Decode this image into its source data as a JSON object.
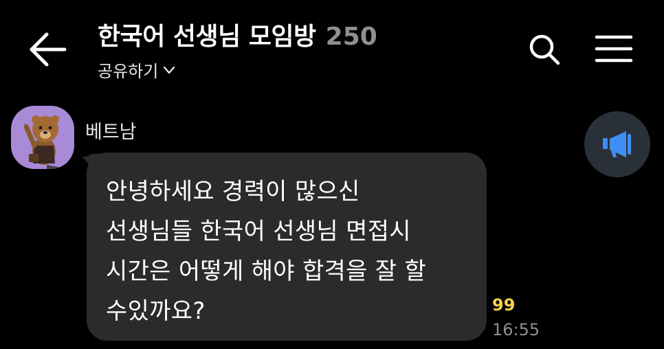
{
  "header": {
    "title": "한국어 선생님 모임방",
    "member_count": "250",
    "share_label": "공유하기"
  },
  "icons": {
    "back": "arrow-left-icon",
    "search": "search-icon",
    "menu": "hamburger-menu-icon",
    "share_dropdown": "chevron-down-icon",
    "notice": "megaphone-icon"
  },
  "message": {
    "sender": "베트남",
    "lines": [
      "안녕하세요  경력이 많으신",
      "선생님들  한국어 선생님 면접시",
      "시간은 어떻게 해야 합격을 잘 할",
      "수있까요?"
    ],
    "unread_count": "99",
    "time": "16:55"
  },
  "colors": {
    "background": "#000000",
    "bubble": "#2b2b2e",
    "unread": "#f5d44a",
    "muted": "#8e8e93",
    "avatar_bg": "#a98ad6",
    "notice_icon": "#3f8ef5"
  }
}
